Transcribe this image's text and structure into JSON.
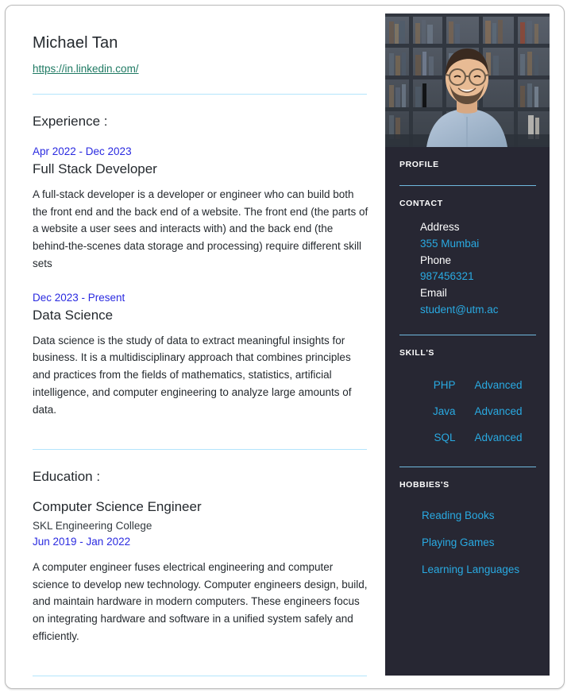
{
  "resume": {
    "header": {
      "name": "Michael Tan",
      "link_text": "https://in.linkedin.com/"
    },
    "experience": {
      "section_title": "Experience :",
      "entries": [
        {
          "date": "Apr 2022 - Dec 2023",
          "title": "Full Stack Developer",
          "description": "A full-stack developer is a developer or engineer who can build both the front end and the back end of a website. The front end (the parts of a website a user sees and interacts with) and the back end (the behind-the-scenes data storage and processing) require different skill sets"
        },
        {
          "date": "Dec 2023 - Present",
          "title": "Data Science",
          "description": "Data science is the study of data to extract meaningful insights for business. It is a multidisciplinary approach that combines principles and practices from the fields of mathematics, statistics, artificial intelligence, and computer engineering to analyze large amounts of data."
        }
      ]
    },
    "education": {
      "section_title": "Education :",
      "entries": [
        {
          "degree": "Computer Science Engineer",
          "institution": "SKL Engineering College",
          "date": "Jun 2019 - Jan 2022",
          "description": "A computer engineer fuses electrical engineering and computer science to develop new technology. Computer engineers design, build, and maintain hardware in modern computers. These engineers focus on integrating hardware and software in a unified system safely and efficiently."
        }
      ]
    },
    "sidebar": {
      "photo_alt": "profile-photo",
      "profile_heading": "PROFILE",
      "contact_heading": "CONTACT",
      "contact": [
        {
          "label": "Address",
          "value": "355 Mumbai"
        },
        {
          "label": "Phone",
          "value": "987456321"
        },
        {
          "label": "Email",
          "value": "student@utm.ac"
        }
      ],
      "skills_heading": "SKILL'S",
      "skills": [
        {
          "name": "PHP",
          "level": "Advanced"
        },
        {
          "name": "Java",
          "level": "Advanced"
        },
        {
          "name": "SQL",
          "level": "Advanced"
        }
      ],
      "hobbies_heading": "HOBBIES'S",
      "hobbies": [
        "Reading Books",
        "Playing Games",
        "Learning Languages"
      ]
    },
    "colors": {
      "sidebar_bg": "#272733",
      "accent_cyan": "#29aae2",
      "accent_blue": "#2a2ae0",
      "link_teal": "#1f7a63",
      "divider_light_blue": "#b3e5fc",
      "divider_sidebar": "#6fb8de"
    }
  }
}
